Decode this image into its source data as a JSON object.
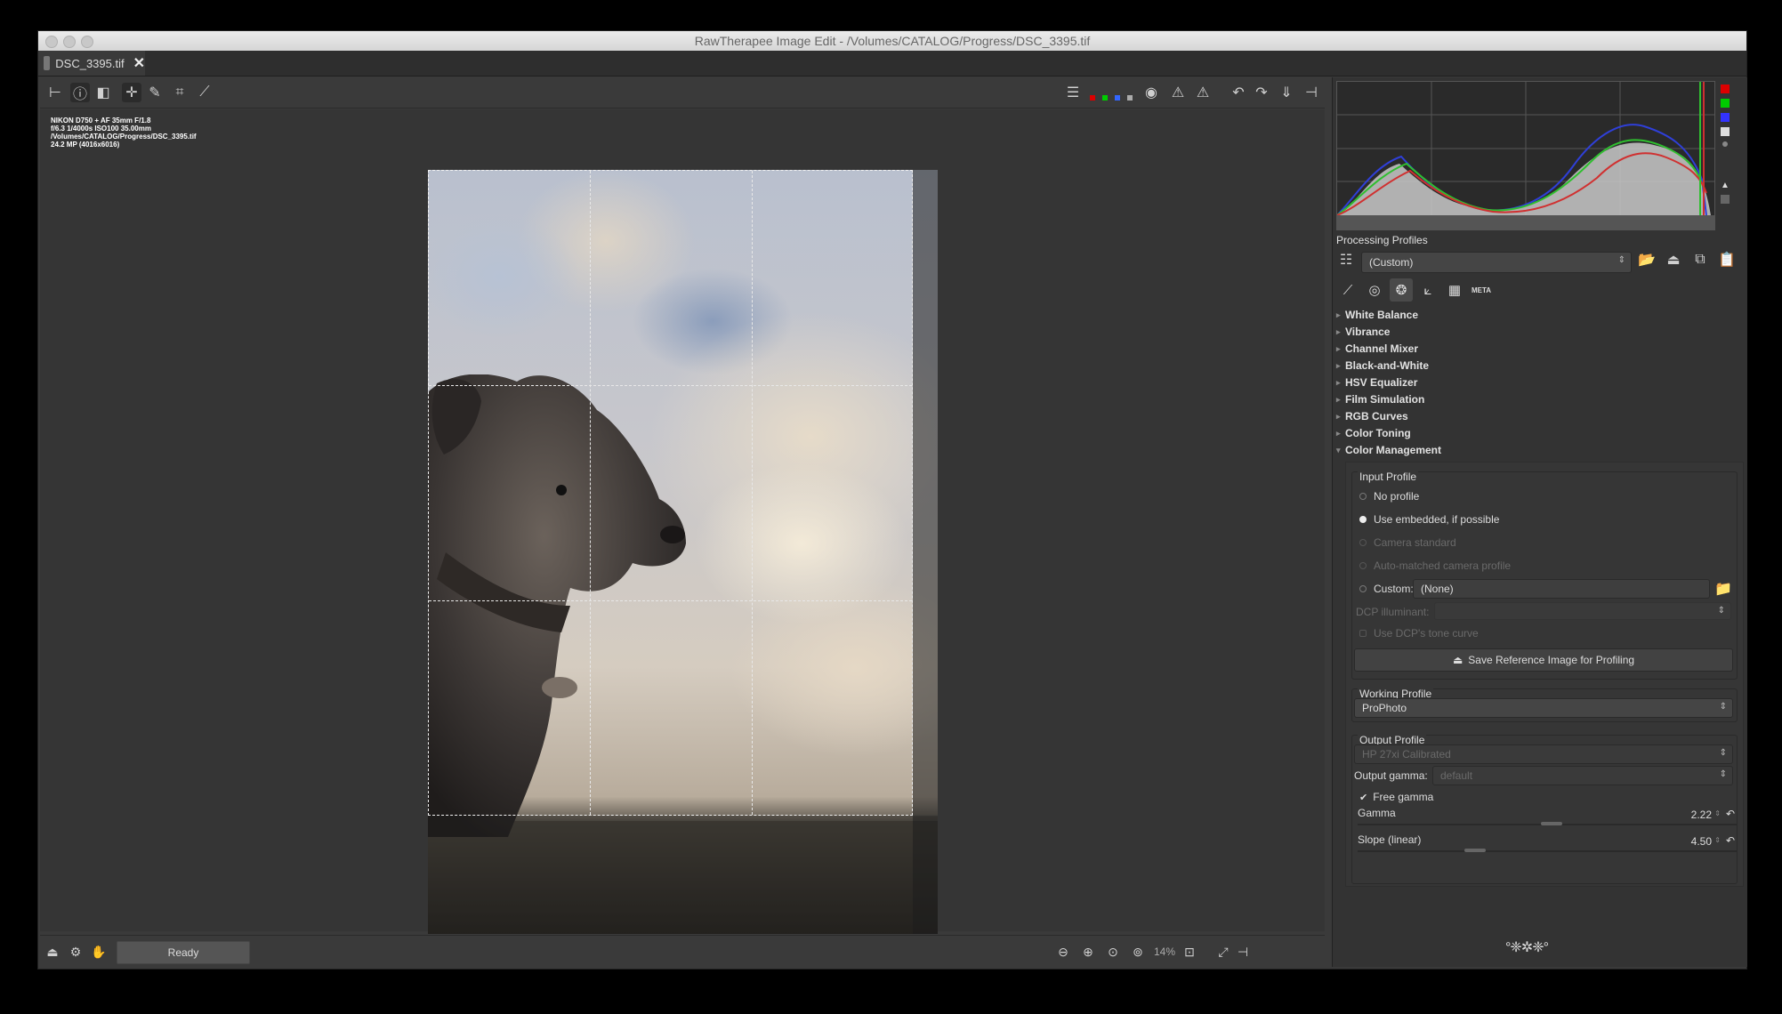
{
  "window": {
    "title": "RawTherapee Image Edit - /Volumes/CATALOG/Progress/DSC_3395.tif"
  },
  "tab": {
    "label": "DSC_3395.tif"
  },
  "exif": {
    "line1": "NIKON D750 + AF 35mm F/1.8",
    "line2": "f/6.3  1/4000s  ISO100  35.00mm",
    "line3": "/Volumes/CATALOG/Progress/DSC_3395.tif",
    "line4": "24.2 MP (4016x6016)"
  },
  "status": {
    "text": "Ready"
  },
  "zoom": {
    "value": "14%"
  },
  "panel": {
    "processing_profiles_title": "Processing Profiles",
    "profile_value": "(Custom)",
    "tools": [
      "White Balance",
      "Vibrance",
      "Channel Mixer",
      "Black-and-White",
      "HSV Equalizer",
      "Film Simulation",
      "RGB Curves",
      "Color Toning",
      "Color Management"
    ],
    "meta_tab_label": "META",
    "color_management": {
      "input_profile": {
        "title": "Input Profile",
        "options": [
          "No profile",
          "Use embedded, if possible",
          "Camera standard",
          "Auto-matched camera profile"
        ],
        "selected": 1,
        "custom_label": "Custom:",
        "custom_value": "(None)",
        "dcp_illuminant_label": "DCP illuminant:",
        "dcp_tone_curve_label": "Use DCP's tone curve",
        "save_reference_label": "Save Reference Image for Profiling"
      },
      "working_profile": {
        "title": "Working Profile",
        "value": "ProPhoto"
      },
      "output_profile": {
        "title": "Output Profile",
        "value": "HP 27xi Calibrated",
        "gamma_label": "Output gamma:",
        "gamma_value": "default",
        "free_gamma_label": "Free gamma",
        "free_gamma_checked": true,
        "gamma_slider": {
          "label": "Gamma",
          "value": "2.22"
        },
        "slope_slider": {
          "label": "Slope (linear)",
          "value": "4.50"
        }
      }
    }
  },
  "colors": {
    "accent": "#3a3a3a",
    "panel": "#333333"
  }
}
